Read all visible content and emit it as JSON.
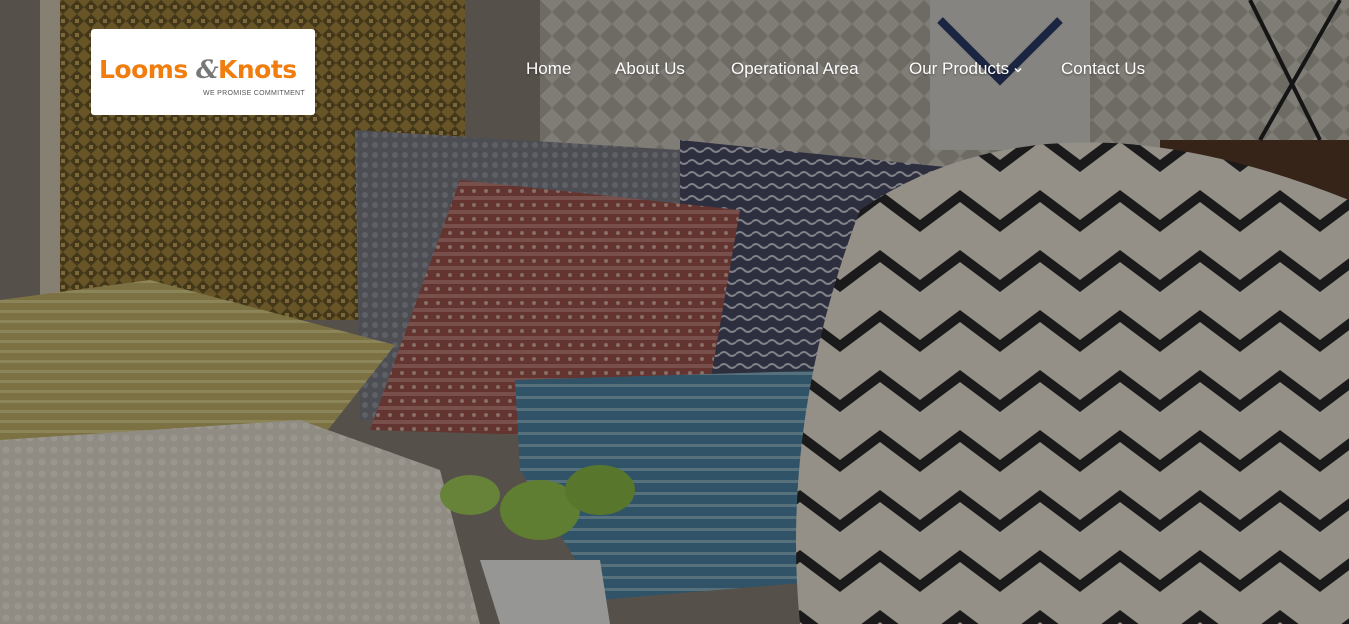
{
  "logo": {
    "word1": "Looms",
    "amp": "&",
    "word2": "Knots",
    "tagline": "WE PROMISE COMMITMENT"
  },
  "nav": {
    "items": [
      {
        "label": "Home"
      },
      {
        "label": "About Us"
      },
      {
        "label": "Operational Area"
      },
      {
        "label": "Our Products"
      },
      {
        "label": "Contact Us"
      }
    ]
  },
  "colors": {
    "brand_orange": "#f07d0e",
    "nav_text": "#ffffff"
  },
  "icons": {
    "dropdown": "chevron-down-icon"
  }
}
